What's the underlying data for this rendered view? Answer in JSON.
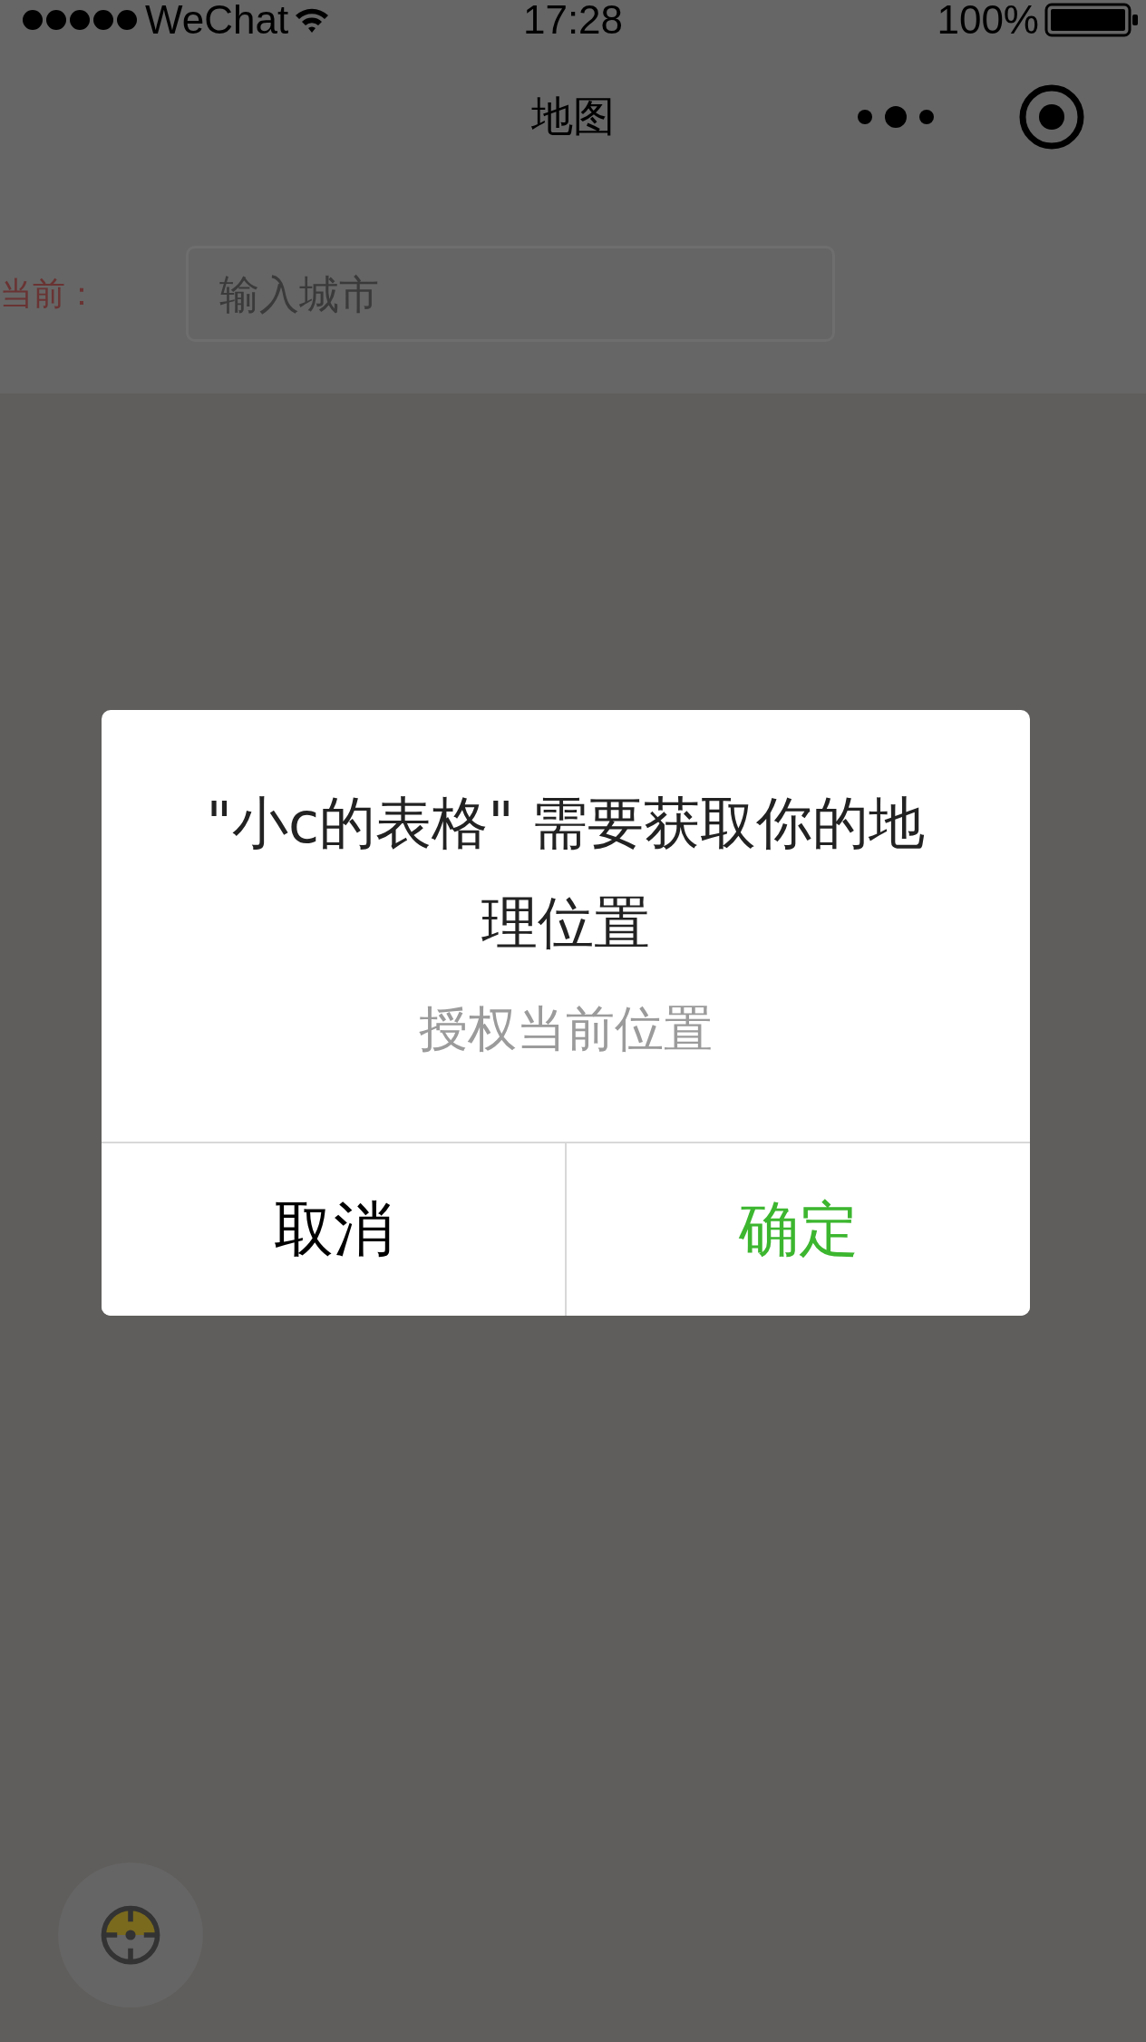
{
  "status_bar": {
    "carrier": "WeChat",
    "time": "17:28",
    "battery": "100%"
  },
  "nav_bar": {
    "title": "地图"
  },
  "search": {
    "label": "当前：",
    "placeholder": "输入城市"
  },
  "dialog": {
    "title": "\"小c的表格\" 需要获取你的地理位置",
    "message": "授权当前位置",
    "buttons": [
      {
        "label": "取消",
        "kind": "cancel"
      },
      {
        "label": "确定",
        "kind": "confirm"
      }
    ]
  }
}
